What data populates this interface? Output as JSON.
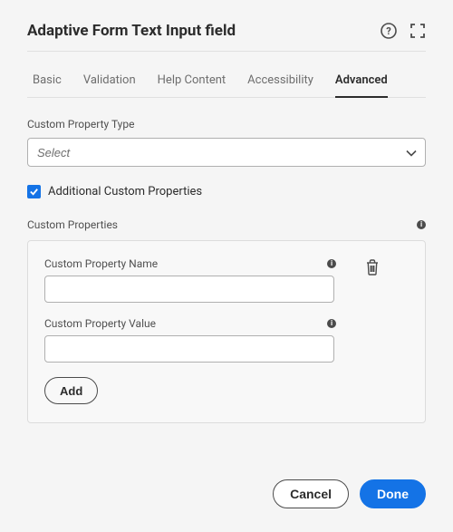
{
  "header": {
    "title": "Adaptive Form Text Input field",
    "icons": {
      "help": "help-icon",
      "fullscreen": "fullscreen-icon"
    }
  },
  "tabs": [
    {
      "label": "Basic",
      "active": false
    },
    {
      "label": "Validation",
      "active": false
    },
    {
      "label": "Help Content",
      "active": false
    },
    {
      "label": "Accessibility",
      "active": false
    },
    {
      "label": "Advanced",
      "active": true
    }
  ],
  "custom_type": {
    "label": "Custom Property Type",
    "placeholder": "Select",
    "value": ""
  },
  "additional_checkbox": {
    "label": "Additional Custom Properties",
    "checked": true
  },
  "properties_section": {
    "label": "Custom Properties",
    "name_label": "Custom Property Name",
    "name_value": "",
    "value_label": "Custom Property Value",
    "value_value": "",
    "add_label": "Add"
  },
  "footer": {
    "cancel": "Cancel",
    "done": "Done"
  }
}
